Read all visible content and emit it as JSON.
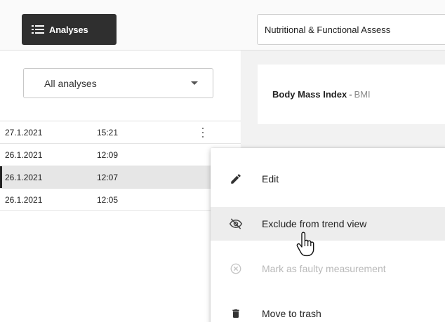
{
  "toolbar": {
    "analyses_label": "Analyses",
    "assessment_value": "Nutritional & Functional Assess"
  },
  "sidebar": {
    "filter_value": "All analyses",
    "rows": [
      {
        "date": "27.1.2021",
        "time": "15:21"
      },
      {
        "date": "26.1.2021",
        "time": "12:09"
      },
      {
        "date": "26.1.2021",
        "time": "12:07"
      },
      {
        "date": "26.1.2021",
        "time": "12:05"
      }
    ]
  },
  "main": {
    "metric_name": "Body Mass Index",
    "metric_separator": "-",
    "metric_abbr": "BMI"
  },
  "context_menu": {
    "items": [
      {
        "label": "Edit",
        "icon": "pencil-icon"
      },
      {
        "label": "Exclude from trend view",
        "icon": "eye-off-icon"
      },
      {
        "label": "Mark as faulty measurement",
        "icon": "cancel-circle-icon"
      },
      {
        "label": "Move to trash",
        "icon": "trash-icon"
      }
    ]
  },
  "colors": {
    "button_dark": "#2f2f2f",
    "hover_bg": "#ededed",
    "disabled_text": "#b8b8b8",
    "selected_row": "#e6e6e6"
  }
}
